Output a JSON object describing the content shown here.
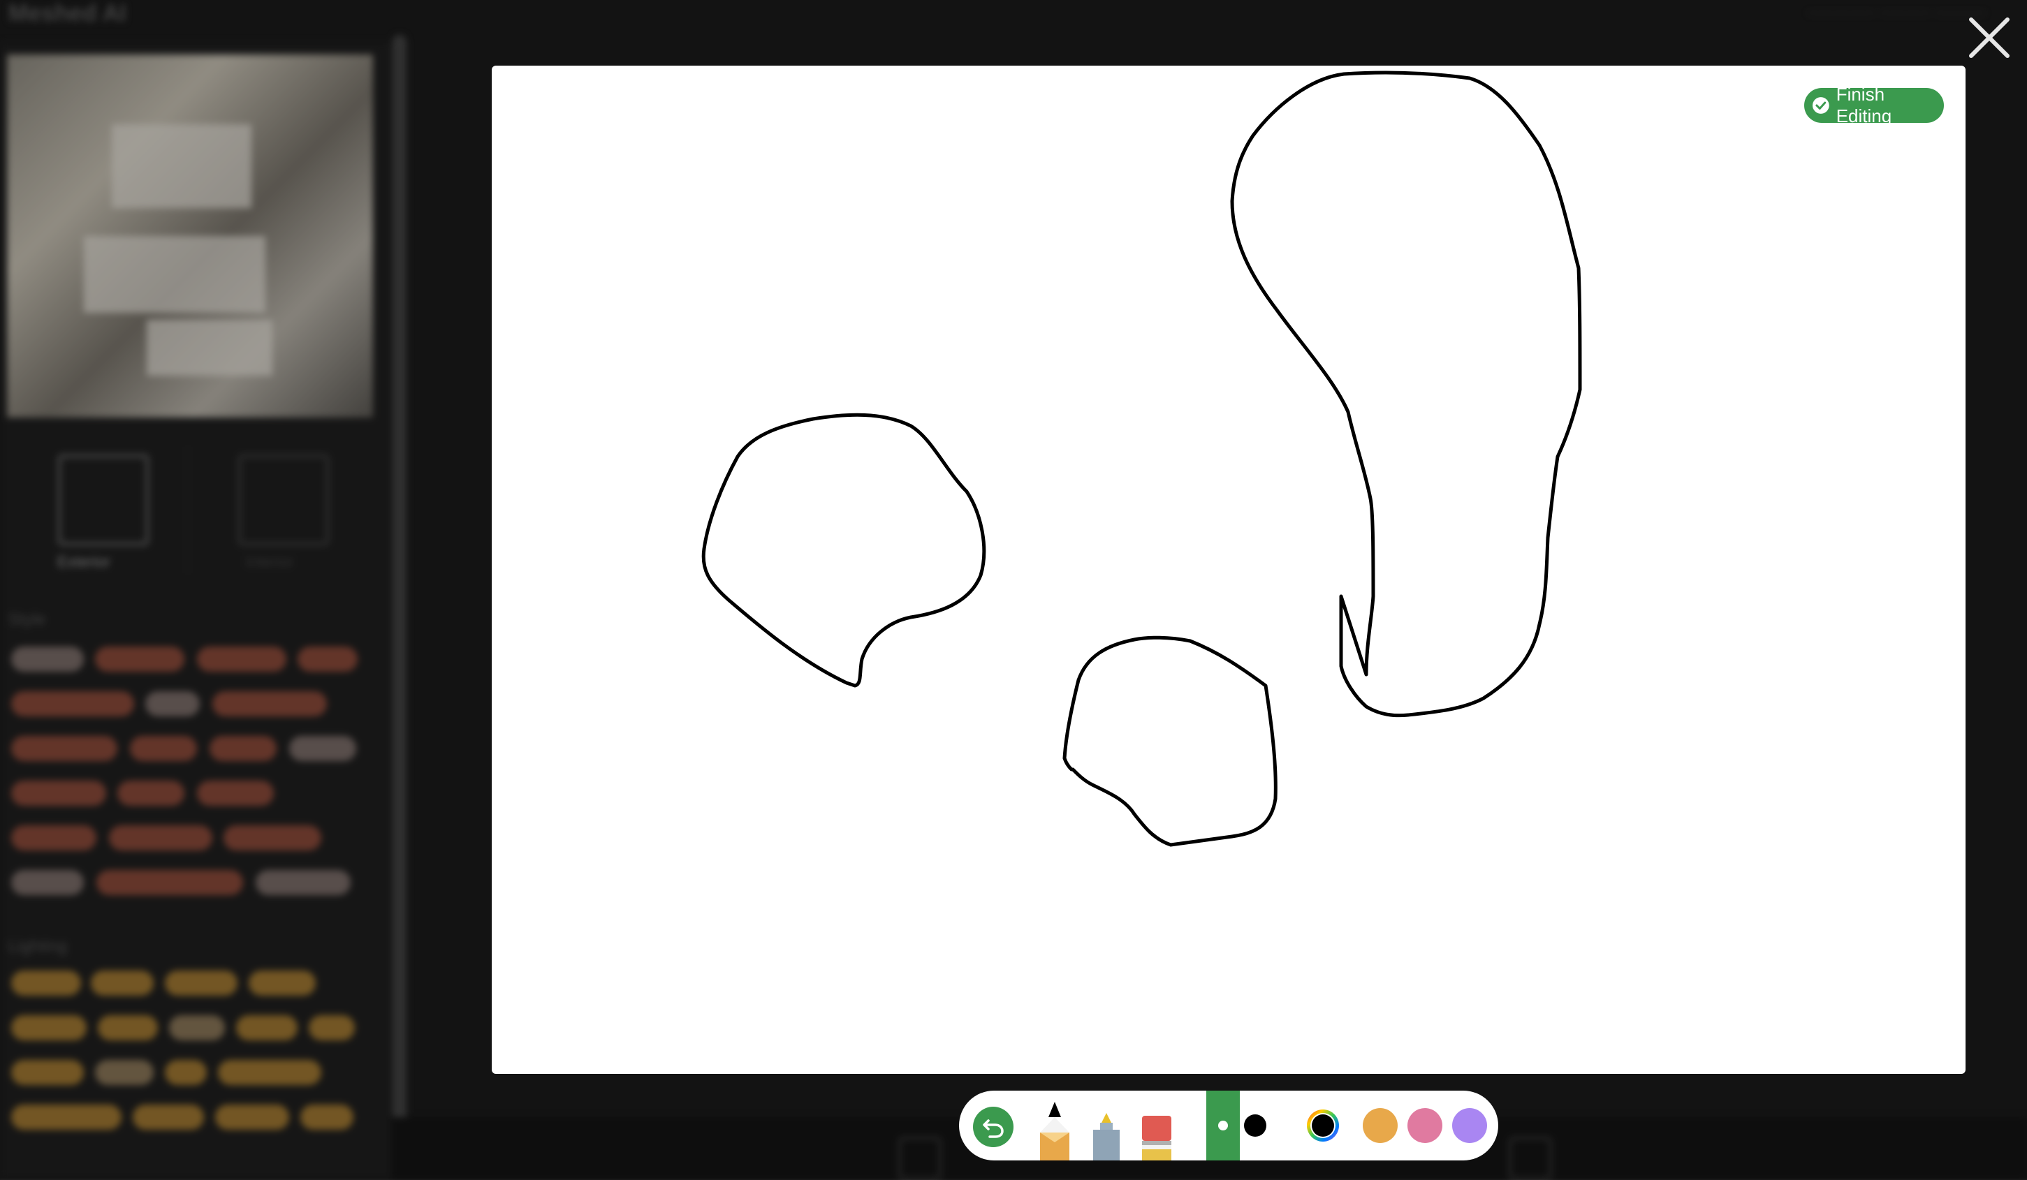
{
  "background_app": {
    "title": "Meshed AI",
    "mode_labels": [
      "Exterior",
      "Interior"
    ],
    "sections": [
      "Style",
      "Lighting"
    ]
  },
  "dialog": {
    "finish_label": "Finish Editing",
    "close_icon": "close-icon"
  },
  "toolbar": {
    "undo_icon": "undo-icon",
    "tools": [
      "pen-tool-icon",
      "marker-tool-icon",
      "eraser-tool-icon"
    ],
    "brush_sizes": [
      "small",
      "large"
    ],
    "colors": {
      "black": "#000000",
      "picker": "color-picker-icon",
      "orange": "#e8a84a",
      "pink": "#e07aa0",
      "purple": "#a986f2"
    },
    "accent": "#3b9a4e"
  }
}
